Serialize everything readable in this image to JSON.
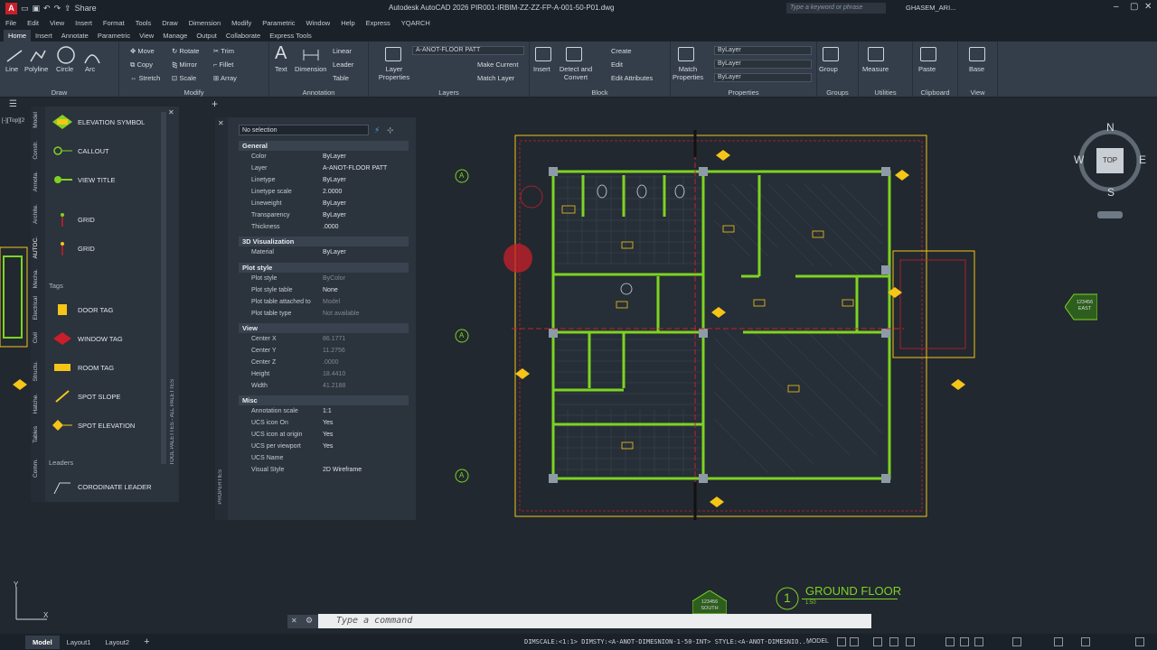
{
  "app": {
    "title": "Autodesk AutoCAD 2026",
    "filename": "PIR001-IRBIM-ZZ-ZZ-FP-A-001-50-P01.dwg",
    "share_label": "Share",
    "search_placeholder": "Type a keyword or phrase",
    "user_name": "GHASEM_ARI..."
  },
  "menu": [
    "File",
    "Edit",
    "View",
    "Insert",
    "Format",
    "Tools",
    "Draw",
    "Dimension",
    "Modify",
    "Parametric",
    "Window",
    "Help",
    "Express",
    "YQARCH"
  ],
  "ribbon_tabs": [
    {
      "label": "Home",
      "active": true
    },
    {
      "label": "Insert"
    },
    {
      "label": "Annotate"
    },
    {
      "label": "Parametric"
    },
    {
      "label": "View"
    },
    {
      "label": "Manage"
    },
    {
      "label": "Output"
    },
    {
      "label": "Collaborate"
    },
    {
      "label": "Express Tools"
    }
  ],
  "ribbon": {
    "draw": {
      "label": "Draw",
      "tools": [
        "Line",
        "Polyline",
        "Circle",
        "Arc"
      ]
    },
    "modify": {
      "label": "Modify",
      "tools": [
        "Move",
        "Rotate",
        "Trim",
        "Copy",
        "Mirror",
        "Fillet",
        "Stretch",
        "Scale",
        "Array"
      ]
    },
    "annotation": {
      "label": "Annotation",
      "tools": [
        "Text",
        "Dimension",
        "Linear",
        "Leader",
        "Table"
      ]
    },
    "layers": {
      "label": "Layers",
      "properties": "Layer Properties",
      "current_layer": "A-ANOT-FLOOR PATT",
      "make_current": "Make Current",
      "match_layer": "Match Layer"
    },
    "block": {
      "label": "Block",
      "insert": "Insert",
      "detect": "Detect and Convert",
      "create": "Create",
      "edit": "Edit",
      "edit_attributes": "Edit Attributes"
    },
    "properties": {
      "label": "Properties",
      "match": "Match Properties",
      "color": "ByLayer",
      "linetype": "ByLayer",
      "lineweight": "ByLayer"
    },
    "groups": {
      "label": "Groups",
      "group": "Group"
    },
    "utilities": {
      "label": "Utilities",
      "measure": "Measure"
    },
    "clipboard": {
      "label": "Clipboard",
      "paste": "Paste"
    },
    "view": {
      "label": "View",
      "base": "Base"
    }
  },
  "doc": {
    "viewport_label": "[-][Top][2"
  },
  "palette": {
    "title": "TOOL PALETTES - ALL PALETTES",
    "side_tabs": [
      "Model",
      "Constr.",
      "Annota.",
      "Archite.",
      "AUTOC.",
      "Mecha.",
      "Electrical",
      "Civil",
      "Structu.",
      "Hatche.",
      "Tables",
      "Comm."
    ],
    "items": [
      {
        "label": "ELEVATION SYMBOL",
        "icon": "elevation-symbol-icon"
      },
      {
        "label": "CALLOUT",
        "icon": "callout-icon"
      },
      {
        "label": "VIEW TITLE",
        "icon": "view-title-icon"
      },
      {
        "label": "GRID",
        "icon": "grid-icon"
      },
      {
        "label": "GRID",
        "icon": "grid-icon"
      }
    ],
    "tags_section": "Tags",
    "tags": [
      {
        "label": "DOOR TAG"
      },
      {
        "label": "WINDOW TAG"
      },
      {
        "label": "ROOM TAG"
      },
      {
        "label": "SPOT SLOPE"
      },
      {
        "label": "SPOT ELEVATION"
      }
    ],
    "leaders_section": "Leaders",
    "leaders": [
      {
        "label": "CORODINATE LEADER"
      }
    ]
  },
  "properties": {
    "panel_label": "PROPERTIES",
    "selection": "No selection",
    "general": {
      "title": "General",
      "rows": [
        {
          "k": "Color",
          "v": "ByLayer"
        },
        {
          "k": "Layer",
          "v": "A-ANOT-FLOOR PATT"
        },
        {
          "k": "Linetype",
          "v": "ByLayer"
        },
        {
          "k": "Linetype scale",
          "v": "2.0000"
        },
        {
          "k": "Lineweight",
          "v": "ByLayer"
        },
        {
          "k": "Transparency",
          "v": "ByLayer"
        },
        {
          "k": "Thickness",
          "v": ".0000"
        }
      ]
    },
    "viz3d": {
      "title": "3D Visualization",
      "rows": [
        {
          "k": "Material",
          "v": "ByLayer"
        }
      ]
    },
    "plot": {
      "title": "Plot style",
      "rows": [
        {
          "k": "Plot style",
          "v": "ByColor"
        },
        {
          "k": "Plot style table",
          "v": "None"
        },
        {
          "k": "Plot table attached to",
          "v": "Model"
        },
        {
          "k": "Plot table type",
          "v": "Not available"
        }
      ]
    },
    "view": {
      "title": "View",
      "rows": [
        {
          "k": "Center X",
          "v": "86.1771"
        },
        {
          "k": "Center Y",
          "v": "11.2756"
        },
        {
          "k": "Center Z",
          "v": ".0000"
        },
        {
          "k": "Height",
          "v": "18.4410"
        },
        {
          "k": "Width",
          "v": "41.2188"
        }
      ]
    },
    "misc": {
      "title": "Misc",
      "rows": [
        {
          "k": "Annotation scale",
          "v": "1:1"
        },
        {
          "k": "UCS icon On",
          "v": "Yes"
        },
        {
          "k": "UCS icon at origin",
          "v": "Yes"
        },
        {
          "k": "UCS per viewport",
          "v": "Yes"
        },
        {
          "k": "UCS Name",
          "v": ""
        },
        {
          "k": "Visual Style",
          "v": "2D Wireframe"
        }
      ]
    }
  },
  "viewcube": {
    "n": "N",
    "s": "S",
    "e": "E",
    "w": "W",
    "top": "TOP"
  },
  "drawing": {
    "grid_bubble": "A",
    "east_marker": "123456 EAST",
    "south_marker": "123456 SOUTH",
    "title_number": "1",
    "title": "GROUND FLOOR",
    "scale": "1:50"
  },
  "command": {
    "placeholder": "Type a command"
  },
  "status": {
    "layouts": [
      {
        "label": "Model",
        "active": true
      },
      {
        "label": "Layout1"
      },
      {
        "label": "Layout2"
      }
    ],
    "text": "DIMSCALE:<1:1> DIMSTY:<A-ANOT-DIMESNION-1-50-INT> STYLE:<A-ANOT-DIMESNIO...",
    "model": "MODEL"
  },
  "colors": {
    "wall": "#7ed321",
    "cad_bg": "#212830",
    "accent_red": "#c81f2a",
    "tag_yellow": "#f5c518"
  }
}
